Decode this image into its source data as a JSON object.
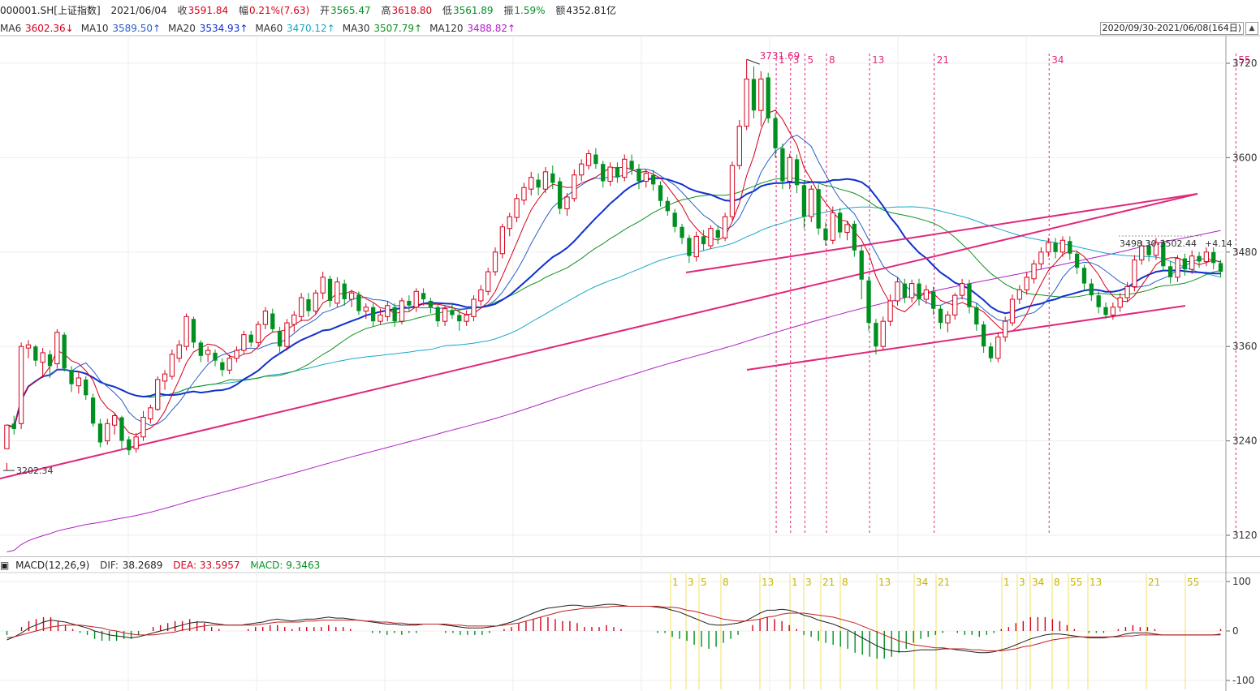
{
  "info": {
    "code": "000001.SH[上证指数]",
    "date": "2021/06/04",
    "close_label": "收",
    "close": "3591.84",
    "change_label": "幅",
    "change": "0.21%(7.63)",
    "open_label": "开",
    "open": "3565.47",
    "high_label": "高",
    "high": "3618.80",
    "low_label": "低",
    "low": "3561.89",
    "amp_label": "振",
    "amp": "1.59%",
    "amount_label": "额",
    "amount": "4352.81亿"
  },
  "ma": [
    {
      "label": "MA6",
      "value": "3602.36↓",
      "color": "#d4001a"
    },
    {
      "label": "MA10",
      "value": "3589.50↑",
      "color": "#2a5ec8"
    },
    {
      "label": "MA20",
      "value": "3534.93↑",
      "color": "#1030d0"
    },
    {
      "label": "MA60",
      "value": "3470.12↑",
      "color": "#18a8c8"
    },
    {
      "label": "MA30",
      "value": "3507.79↑",
      "color": "#109020"
    },
    {
      "label": "MA120",
      "value": "3488.82↑",
      "color": "#b020c8"
    }
  ],
  "range": "2020/09/30-2021/06/08(164日)",
  "macd": {
    "title": "MACD(12,26,9)",
    "dif_label": "DIF:",
    "dif": "38.2689",
    "dea_label": "DEA:",
    "dea": "33.5957",
    "macd_label": "MACD:",
    "macd": "9.3463"
  },
  "colors": {
    "up": "#d4001a",
    "down": "#009020",
    "trend": "#e0287a",
    "fib_macd": "#f0e060"
  },
  "chart_data": {
    "type": "candlestick",
    "price_axis": {
      "min": 3120,
      "max": 3720,
      "ticks": [
        3120,
        3240,
        3360,
        3480,
        3600,
        3720
      ]
    },
    "macd_axis": {
      "ticks": [
        100,
        0,
        -100
      ]
    },
    "annotations": {
      "low_label": "3202.34",
      "high_label": "3731.69",
      "channel_label": "3498.30-3502.44",
      "channel_delta": "+4.14"
    },
    "fib_labels_price": [
      "1",
      "3",
      "5",
      "8",
      "13",
      "21",
      "34",
      "55"
    ],
    "fib_labels_macd": [
      "1",
      "3",
      "5",
      "8",
      "13",
      "1",
      "3",
      "21",
      "8",
      "13",
      "34",
      "21",
      "1",
      "3",
      "34",
      "8",
      "55",
      "13",
      "21",
      "55"
    ],
    "candles": [
      [
        3230,
        3260,
        3212,
        3202
      ],
      [
        3262,
        3255,
        3272,
        3248
      ],
      [
        3262,
        3360,
        3365,
        3255
      ],
      [
        3358,
        3362,
        3368,
        3345
      ],
      [
        3360,
        3342,
        3362,
        3335
      ],
      [
        3340,
        3352,
        3358,
        3320
      ],
      [
        3350,
        3335,
        3355,
        3320
      ],
      [
        3338,
        3378,
        3382,
        3332
      ],
      [
        3375,
        3332,
        3378,
        3328
      ],
      [
        3330,
        3312,
        3335,
        3302
      ],
      [
        3310,
        3320,
        3328,
        3300
      ],
      [
        3318,
        3298,
        3322,
        3292
      ],
      [
        3295,
        3262,
        3300,
        3258
      ],
      [
        3262,
        3238,
        3268,
        3232
      ],
      [
        3240,
        3262,
        3268,
        3235
      ],
      [
        3260,
        3272,
        3275,
        3248
      ],
      [
        3270,
        3240,
        3272,
        3230
      ],
      [
        3242,
        3228,
        3246,
        3222
      ],
      [
        3230,
        3245,
        3250,
        3225
      ],
      [
        3245,
        3270,
        3278,
        3240
      ],
      [
        3268,
        3282,
        3286,
        3262
      ],
      [
        3280,
        3318,
        3322,
        3278
      ],
      [
        3316,
        3325,
        3330,
        3305
      ],
      [
        3322,
        3350,
        3356,
        3318
      ],
      [
        3345,
        3362,
        3368,
        3340
      ],
      [
        3360,
        3398,
        3402,
        3355
      ],
      [
        3395,
        3365,
        3398,
        3358
      ],
      [
        3365,
        3348,
        3368,
        3340
      ],
      [
        3350,
        3355,
        3360,
        3340
      ],
      [
        3352,
        3342,
        3356,
        3335
      ],
      [
        3340,
        3330,
        3345,
        3322
      ],
      [
        3330,
        3345,
        3350,
        3325
      ],
      [
        3345,
        3355,
        3360,
        3340
      ],
      [
        3355,
        3375,
        3380,
        3350
      ],
      [
        3375,
        3365,
        3380,
        3360
      ],
      [
        3365,
        3388,
        3392,
        3360
      ],
      [
        3388,
        3405,
        3410,
        3382
      ],
      [
        3402,
        3382,
        3408,
        3378
      ],
      [
        3380,
        3360,
        3385,
        3350
      ],
      [
        3360,
        3390,
        3395,
        3355
      ],
      [
        3388,
        3400,
        3405,
        3378
      ],
      [
        3398,
        3422,
        3428,
        3392
      ],
      [
        3420,
        3405,
        3428,
        3398
      ],
      [
        3405,
        3428,
        3432,
        3400
      ],
      [
        3428,
        3448,
        3455,
        3420
      ],
      [
        3446,
        3418,
        3450,
        3410
      ],
      [
        3415,
        3442,
        3448,
        3410
      ],
      [
        3440,
        3420,
        3445,
        3412
      ],
      [
        3420,
        3428,
        3432,
        3410
      ],
      [
        3426,
        3405,
        3430,
        3400
      ],
      [
        3405,
        3410,
        3415,
        3395
      ],
      [
        3410,
        3392,
        3415,
        3385
      ],
      [
        3392,
        3400,
        3408,
        3388
      ],
      [
        3398,
        3412,
        3418,
        3392
      ],
      [
        3410,
        3392,
        3415,
        3385
      ],
      [
        3392,
        3418,
        3422,
        3388
      ],
      [
        3418,
        3412,
        3425,
        3405
      ],
      [
        3410,
        3430,
        3434,
        3404
      ],
      [
        3428,
        3420,
        3434,
        3412
      ],
      [
        3418,
        3410,
        3422,
        3402
      ],
      [
        3410,
        3392,
        3415,
        3385
      ],
      [
        3392,
        3408,
        3412,
        3386
      ],
      [
        3406,
        3400,
        3414,
        3395
      ],
      [
        3400,
        3392,
        3408,
        3380
      ],
      [
        3392,
        3400,
        3406,
        3386
      ],
      [
        3398,
        3420,
        3425,
        3392
      ],
      [
        3418,
        3432,
        3438,
        3412
      ],
      [
        3430,
        3455,
        3460,
        3425
      ],
      [
        3455,
        3480,
        3486,
        3450
      ],
      [
        3478,
        3512,
        3516,
        3472
      ],
      [
        3510,
        3525,
        3530,
        3500
      ],
      [
        3524,
        3548,
        3554,
        3518
      ],
      [
        3546,
        3562,
        3568,
        3540
      ],
      [
        3560,
        3575,
        3582,
        3552
      ],
      [
        3572,
        3562,
        3580,
        3552
      ],
      [
        3560,
        3582,
        3588,
        3555
      ],
      [
        3580,
        3568,
        3590,
        3560
      ],
      [
        3570,
        3535,
        3575,
        3528
      ],
      [
        3535,
        3550,
        3555,
        3526
      ],
      [
        3548,
        3578,
        3585,
        3544
      ],
      [
        3578,
        3592,
        3598,
        3570
      ],
      [
        3590,
        3605,
        3610,
        3585
      ],
      [
        3604,
        3592,
        3612,
        3586
      ],
      [
        3592,
        3570,
        3596,
        3562
      ],
      [
        3570,
        3588,
        3594,
        3564
      ],
      [
        3588,
        3575,
        3594,
        3568
      ],
      [
        3575,
        3598,
        3604,
        3570
      ],
      [
        3596,
        3585,
        3604,
        3578
      ],
      [
        3586,
        3570,
        3592,
        3560
      ],
      [
        3570,
        3580,
        3585,
        3562
      ],
      [
        3578,
        3566,
        3584,
        3558
      ],
      [
        3565,
        3545,
        3570,
        3538
      ],
      [
        3545,
        3532,
        3550,
        3526
      ],
      [
        3530,
        3512,
        3535,
        3505
      ],
      [
        3512,
        3498,
        3516,
        3490
      ],
      [
        3498,
        3475,
        3502,
        3466
      ],
      [
        3474,
        3500,
        3506,
        3468
      ],
      [
        3500,
        3490,
        3508,
        3482
      ],
      [
        3488,
        3510,
        3514,
        3484
      ],
      [
        3508,
        3498,
        3514,
        3490
      ],
      [
        3498,
        3525,
        3530,
        3494
      ],
      [
        3525,
        3590,
        3595,
        3520
      ],
      [
        3590,
        3640,
        3648,
        3585
      ],
      [
        3640,
        3700,
        3725,
        3635
      ],
      [
        3700,
        3660,
        3716,
        3650
      ],
      [
        3660,
        3700,
        3710,
        3640
      ],
      [
        3702,
        3650,
        3708,
        3644
      ],
      [
        3650,
        3612,
        3656,
        3600
      ],
      [
        3612,
        3570,
        3618,
        3560
      ],
      [
        3570,
        3600,
        3605,
        3560
      ],
      [
        3598,
        3565,
        3604,
        3555
      ],
      [
        3565,
        3525,
        3570,
        3510
      ],
      [
        3525,
        3560,
        3565,
        3518
      ],
      [
        3560,
        3510,
        3566,
        3502
      ],
      [
        3510,
        3495,
        3518,
        3488
      ],
      [
        3495,
        3530,
        3538,
        3490
      ],
      [
        3530,
        3505,
        3536,
        3498
      ],
      [
        3505,
        3515,
        3520,
        3495
      ],
      [
        3516,
        3482,
        3520,
        3474
      ],
      [
        3482,
        3445,
        3488,
        3420
      ],
      [
        3444,
        3390,
        3450,
        3380
      ],
      [
        3390,
        3360,
        3395,
        3350
      ],
      [
        3360,
        3392,
        3398,
        3355
      ],
      [
        3392,
        3418,
        3426,
        3386
      ],
      [
        3418,
        3442,
        3448,
        3412
      ],
      [
        3440,
        3422,
        3446,
        3415
      ],
      [
        3422,
        3440,
        3445,
        3416
      ],
      [
        3440,
        3420,
        3446,
        3412
      ],
      [
        3420,
        3432,
        3438,
        3414
      ],
      [
        3430,
        3408,
        3436,
        3400
      ],
      [
        3408,
        3390,
        3412,
        3382
      ],
      [
        3390,
        3400,
        3405,
        3378
      ],
      [
        3400,
        3425,
        3428,
        3394
      ],
      [
        3425,
        3440,
        3446,
        3420
      ],
      [
        3440,
        3410,
        3445,
        3402
      ],
      [
        3410,
        3388,
        3415,
        3380
      ],
      [
        3388,
        3360,
        3392,
        3352
      ],
      [
        3360,
        3345,
        3365,
        3340
      ],
      [
        3345,
        3372,
        3378,
        3340
      ],
      [
        3372,
        3392,
        3398,
        3366
      ],
      [
        3390,
        3420,
        3426,
        3386
      ],
      [
        3420,
        3432,
        3438,
        3414
      ],
      [
        3432,
        3448,
        3455,
        3426
      ],
      [
        3446,
        3465,
        3470,
        3440
      ],
      [
        3465,
        3480,
        3486,
        3458
      ],
      [
        3480,
        3492,
        3498,
        3474
      ],
      [
        3492,
        3480,
        3498,
        3472
      ],
      [
        3480,
        3495,
        3500,
        3474
      ],
      [
        3494,
        3478,
        3500,
        3470
      ],
      [
        3478,
        3460,
        3482,
        3452
      ],
      [
        3460,
        3440,
        3464,
        3430
      ],
      [
        3440,
        3425,
        3446,
        3418
      ],
      [
        3425,
        3410,
        3430,
        3402
      ],
      [
        3410,
        3400,
        3416,
        3395
      ],
      [
        3400,
        3410,
        3416,
        3394
      ],
      [
        3410,
        3422,
        3428,
        3404
      ],
      [
        3422,
        3436,
        3442,
        3416
      ],
      [
        3436,
        3470,
        3476,
        3430
      ],
      [
        3470,
        3488,
        3494,
        3464
      ],
      [
        3488,
        3476,
        3494,
        3468
      ],
      [
        3476,
        3492,
        3498,
        3470
      ],
      [
        3492,
        3462,
        3496,
        3456
      ],
      [
        3462,
        3448,
        3468,
        3440
      ],
      [
        3448,
        3472,
        3476,
        3442
      ],
      [
        3472,
        3458,
        3478,
        3450
      ],
      [
        3458,
        3475,
        3482,
        3452
      ],
      [
        3475,
        3468,
        3480,
        3460
      ],
      [
        3468,
        3480,
        3486,
        3462
      ],
      [
        3480,
        3466,
        3486,
        3458
      ],
      [
        3466,
        3455,
        3470,
        3448
      ]
    ],
    "macd_dif": [
      -18,
      -12,
      -4,
      6,
      12,
      18,
      22,
      20,
      18,
      14,
      10,
      6,
      0,
      -4,
      -8,
      -10,
      -12,
      -14,
      -12,
      -8,
      -4,
      0,
      4,
      8,
      12,
      16,
      18,
      18,
      16,
      14,
      12,
      12,
      12,
      14,
      16,
      18,
      22,
      24,
      22,
      20,
      22,
      24,
      24,
      26,
      28,
      26,
      26,
      24,
      22,
      20,
      18,
      16,
      14,
      14,
      12,
      12,
      12,
      14,
      14,
      14,
      12,
      10,
      8,
      6,
      6,
      6,
      8,
      10,
      14,
      18,
      24,
      30,
      36,
      42,
      46,
      48,
      50,
      52,
      52,
      50,
      50,
      52,
      54,
      54,
      52,
      50,
      50,
      50,
      50,
      48,
      46,
      42,
      38,
      32,
      26,
      20,
      14,
      12,
      12,
      14,
      16,
      20,
      28,
      36,
      42,
      42,
      44,
      42,
      38,
      32,
      28,
      22,
      18,
      14,
      8,
      2,
      -6,
      -14,
      -22,
      -30,
      -36,
      -40,
      -42,
      -42,
      -40,
      -38,
      -38,
      -38,
      -36,
      -36,
      -38,
      -40,
      -42,
      -44,
      -44,
      -42,
      -38,
      -34,
      -28,
      -22,
      -16,
      -12,
      -8,
      -6,
      -6,
      -8,
      -10,
      -12,
      -14,
      -14,
      -14,
      -12,
      -10,
      -6,
      -4,
      -4,
      -4,
      -6,
      -8,
      -8,
      -8,
      -8,
      -8,
      -8,
      -8,
      -8,
      -6
    ],
    "macd_dea": [
      -14,
      -12,
      -8,
      -4,
      0,
      4,
      8,
      10,
      12,
      12,
      12,
      10,
      8,
      6,
      2,
      0,
      -4,
      -6,
      -8,
      -8,
      -8,
      -6,
      -4,
      -2,
      2,
      4,
      8,
      10,
      12,
      12,
      12,
      12,
      12,
      12,
      12,
      14,
      16,
      18,
      18,
      18,
      18,
      20,
      20,
      22,
      22,
      22,
      22,
      22,
      22,
      20,
      20,
      18,
      18,
      16,
      16,
      14,
      14,
      14,
      14,
      14,
      14,
      12,
      12,
      10,
      10,
      10,
      10,
      10,
      12,
      14,
      16,
      20,
      24,
      28,
      32,
      36,
      40,
      42,
      44,
      46,
      46,
      48,
      48,
      50,
      50,
      50,
      50,
      50,
      50,
      50,
      48,
      48,
      46,
      42,
      40,
      36,
      32,
      28,
      24,
      22,
      20,
      20,
      22,
      24,
      28,
      30,
      34,
      36,
      36,
      36,
      34,
      32,
      30,
      28,
      24,
      20,
      16,
      10,
      4,
      -2,
      -8,
      -14,
      -20,
      -24,
      -28,
      -30,
      -32,
      -34,
      -34,
      -36,
      -36,
      -36,
      -38,
      -38,
      -40,
      -40,
      -40,
      -38,
      -36,
      -32,
      -30,
      -26,
      -22,
      -18,
      -16,
      -14,
      -12,
      -12,
      -12,
      -12,
      -12,
      -12,
      -12,
      -10,
      -10,
      -8,
      -8,
      -8,
      -8,
      -8,
      -8,
      -8,
      -8,
      -8,
      -8,
      -8,
      -8
    ]
  }
}
